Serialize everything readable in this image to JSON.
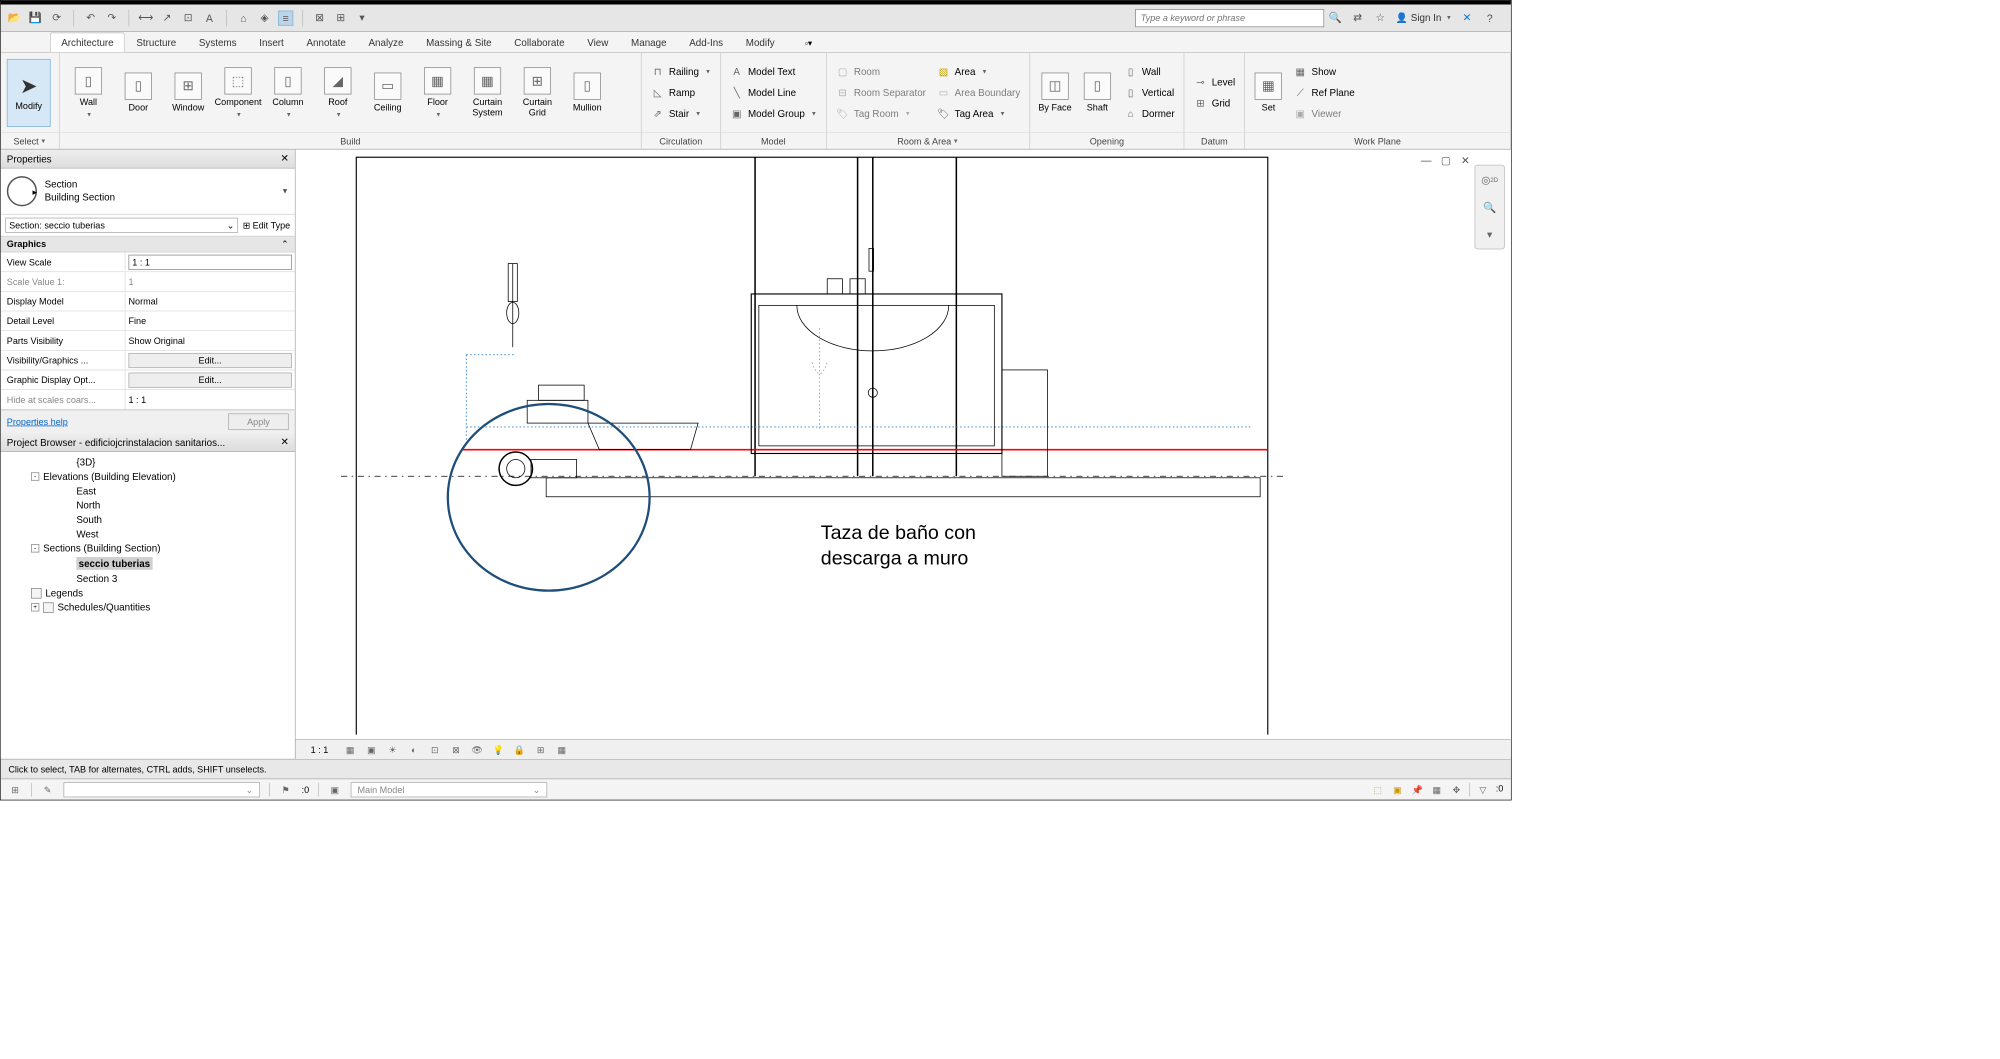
{
  "qat": {
    "search_placeholder": "Type a keyword or phrase",
    "signin": "Sign In"
  },
  "tabs": [
    "Architecture",
    "Structure",
    "Systems",
    "Insert",
    "Annotate",
    "Analyze",
    "Massing & Site",
    "Collaborate",
    "View",
    "Manage",
    "Add-Ins",
    "Modify"
  ],
  "active_tab": "Architecture",
  "ribbon": {
    "modify": "Modify",
    "select": "Select",
    "build": {
      "title": "Build",
      "items": [
        "Wall",
        "Door",
        "Window",
        "Component",
        "Column",
        "Roof",
        "Ceiling",
        "Floor",
        "Curtain System",
        "Curtain Grid",
        "Mullion"
      ]
    },
    "circulation": {
      "title": "Circulation",
      "railing": "Railing",
      "ramp": "Ramp",
      "stair": "Stair"
    },
    "model": {
      "title": "Model",
      "text": "Model Text",
      "line": "Model Line",
      "group": "Model Group"
    },
    "room_area": {
      "title": "Room & Area",
      "room": "Room",
      "sep": "Room Separator",
      "tagroom": "Tag Room",
      "area": "Area",
      "areab": "Area Boundary",
      "tagarea": "Tag Area"
    },
    "opening": {
      "title": "Opening",
      "byface": "By Face",
      "shaft": "Shaft",
      "wall": "Wall",
      "vertical": "Vertical",
      "dormer": "Dormer"
    },
    "datum": {
      "title": "Datum",
      "level": "Level",
      "grid": "Grid"
    },
    "workplane": {
      "title": "Work Plane",
      "set": "Set",
      "show": "Show",
      "ref": "Ref Plane",
      "viewer": "Viewer"
    }
  },
  "properties": {
    "title": "Properties",
    "type_family": "Section",
    "type_name": "Building Section",
    "instance": "Section: seccio tuberias",
    "edit_type": "Edit Type",
    "section": "Graphics",
    "rows": [
      {
        "k": "View Scale",
        "v": "1 : 1",
        "input": true
      },
      {
        "k": "Scale Value    1:",
        "v": "1"
      },
      {
        "k": "Display Model",
        "v": "Normal"
      },
      {
        "k": "Detail Level",
        "v": "Fine"
      },
      {
        "k": "Parts Visibility",
        "v": "Show Original"
      },
      {
        "k": "Visibility/Graphics ...",
        "v": "Edit...",
        "btn": true
      },
      {
        "k": "Graphic Display Opt...",
        "v": "Edit...",
        "btn": true
      },
      {
        "k": "Hide at scales coars...",
        "v": "1 : 1"
      }
    ],
    "help": "Properties help",
    "apply": "Apply"
  },
  "browser": {
    "title": "Project Browser - edificiojcrinstalacion sanitarios...",
    "items": [
      {
        "lvl": 3,
        "label": "{3D}"
      },
      {
        "lvl": 1,
        "label": "Elevations (Building Elevation)",
        "toggle": "-"
      },
      {
        "lvl": 3,
        "label": "East"
      },
      {
        "lvl": 3,
        "label": "North"
      },
      {
        "lvl": 3,
        "label": "South"
      },
      {
        "lvl": 3,
        "label": "West"
      },
      {
        "lvl": 1,
        "label": "Sections (Building Section)",
        "toggle": "-"
      },
      {
        "lvl": 3,
        "label": "seccio tuberias",
        "selected": true
      },
      {
        "lvl": 3,
        "label": "Section 3"
      },
      {
        "lvl": 1,
        "label": "Legends",
        "icon": true
      },
      {
        "lvl": 1,
        "label": "Schedules/Quantities",
        "icon": true,
        "toggle": "+"
      }
    ]
  },
  "annotation": {
    "line1": "Taza de baño con",
    "line2": "descarga a muro"
  },
  "viewbar": {
    "scale": "1 : 1"
  },
  "statusbar": {
    "hint": "Click to select, TAB for alternates, CTRL adds, SHIFT unselects.",
    "zero": ":0",
    "mainmodel": "Main Model"
  }
}
